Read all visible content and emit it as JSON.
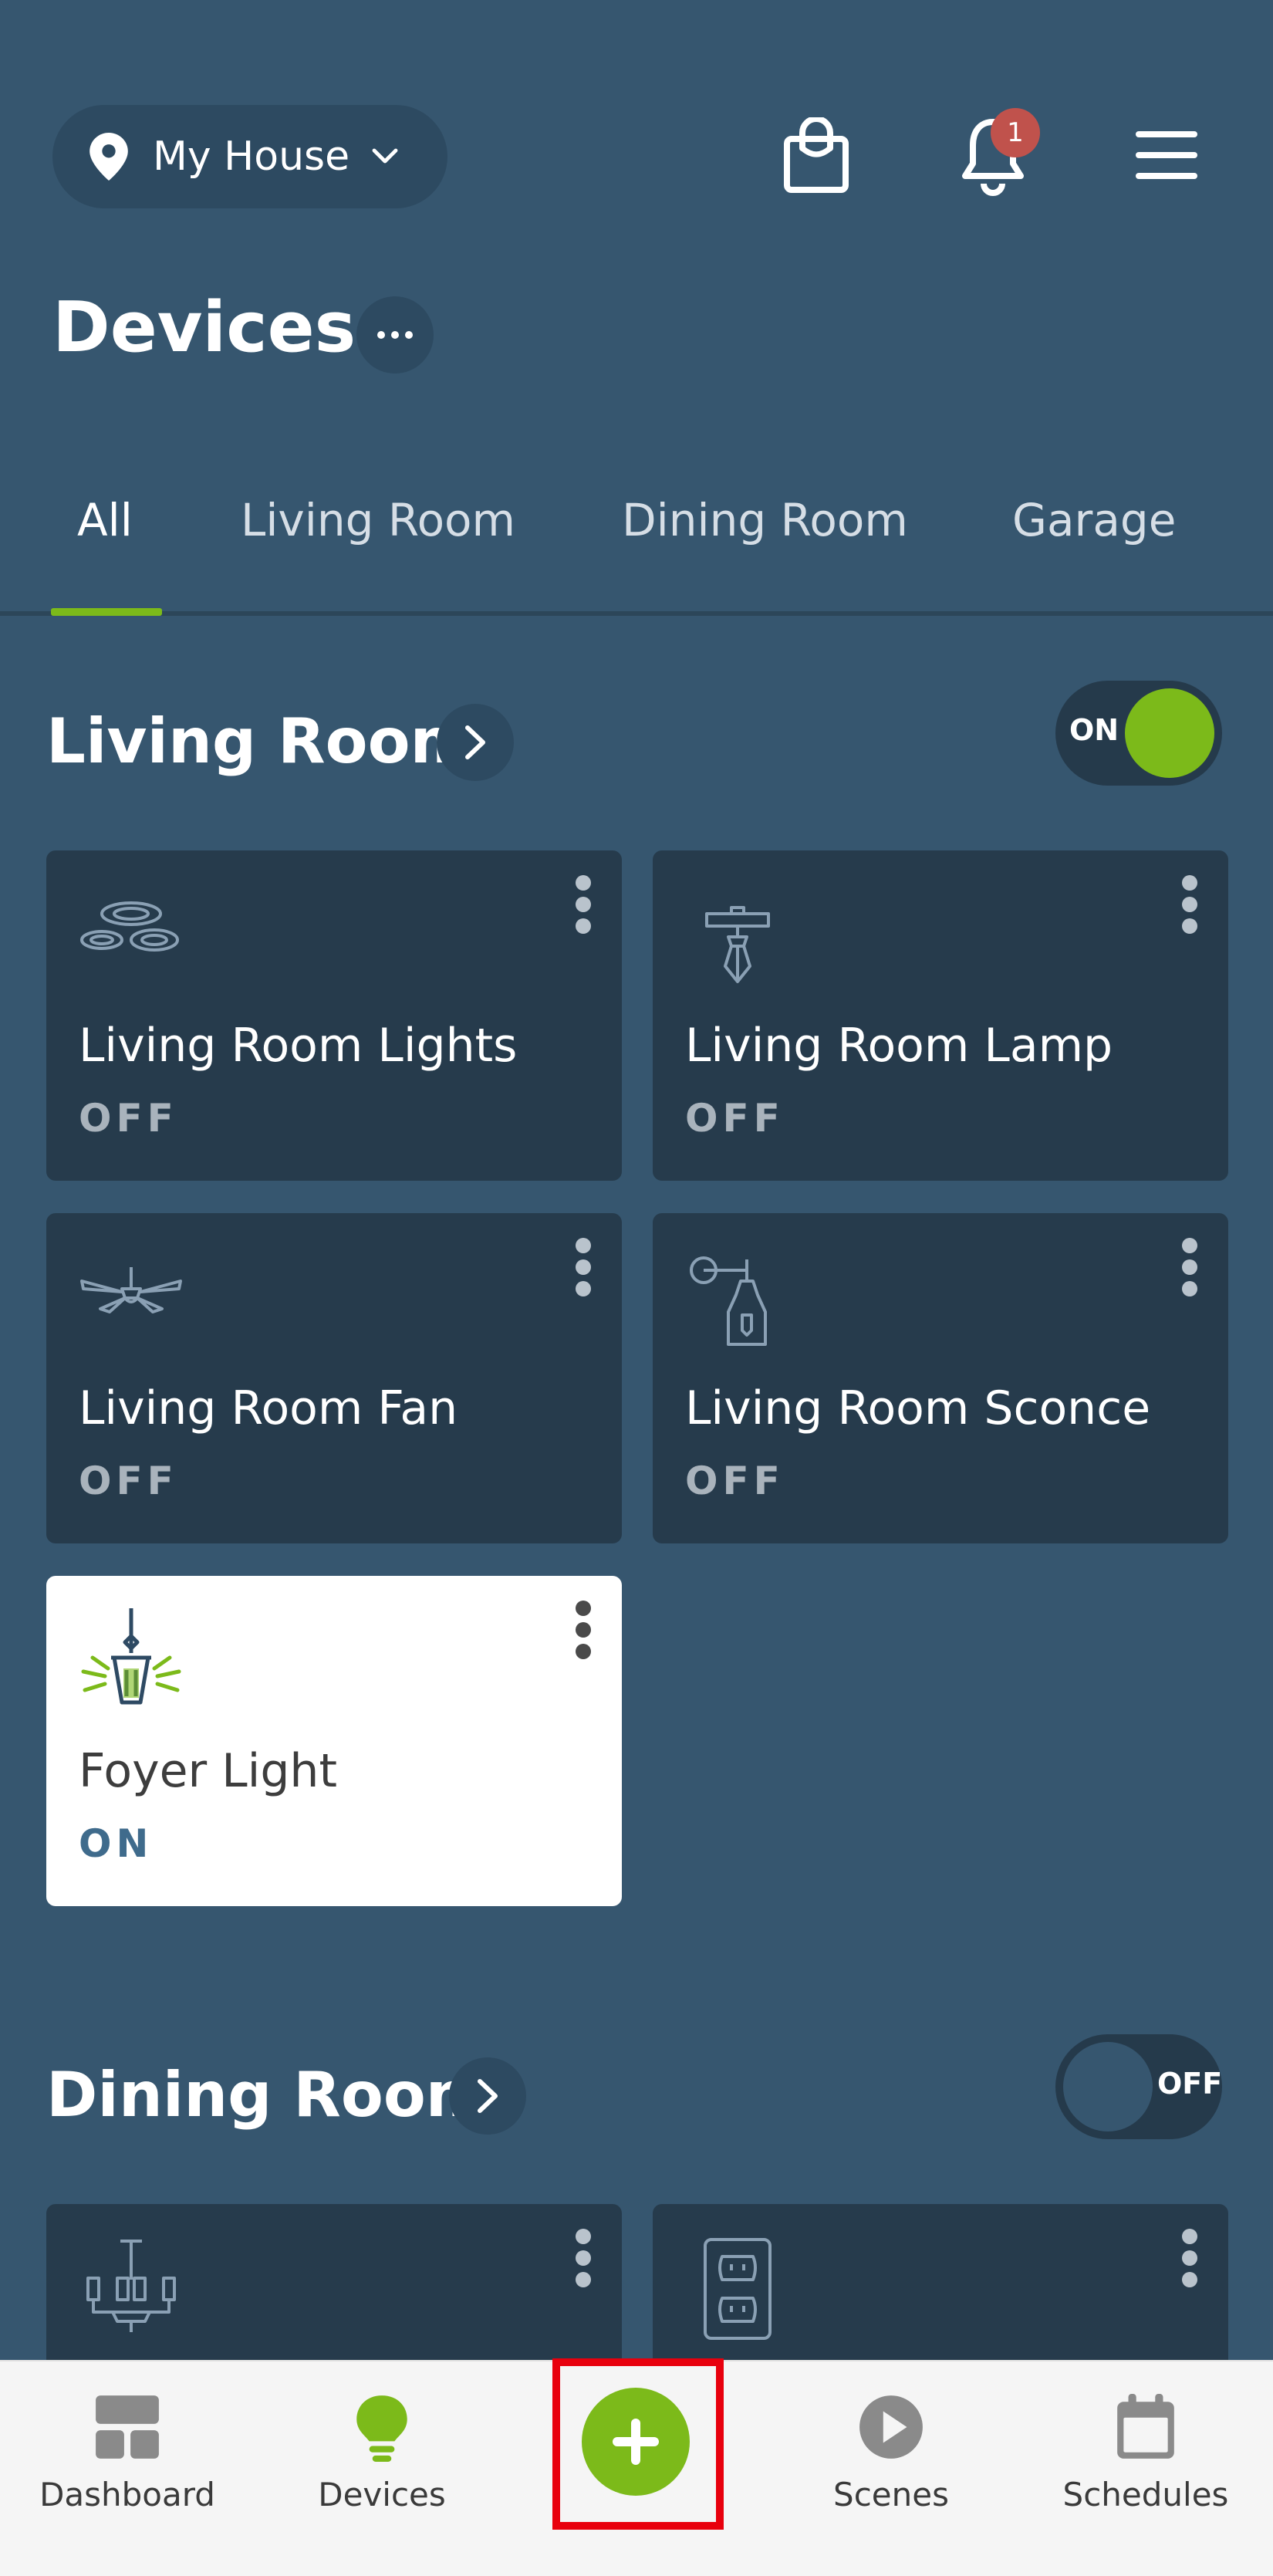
{
  "header": {
    "location": "My House",
    "notification_count": "1"
  },
  "page": {
    "title": "Devices"
  },
  "tabs": [
    {
      "label": "All",
      "active": true
    },
    {
      "label": "Living Room",
      "active": false
    },
    {
      "label": "Dining Room",
      "active": false
    },
    {
      "label": "Garage",
      "active": false
    }
  ],
  "sections": [
    {
      "title": "Living Room",
      "toggle": "ON",
      "devices": [
        {
          "name": "Living Room Lights",
          "status": "OFF",
          "icon": "recessed-lights-icon"
        },
        {
          "name": "Living Room Lamp",
          "status": "OFF",
          "icon": "table-lamp-icon"
        },
        {
          "name": "Living Room Fan",
          "status": "OFF",
          "icon": "ceiling-fan-icon"
        },
        {
          "name": "Living Room Sconce",
          "status": "OFF",
          "icon": "wall-sconce-icon"
        },
        {
          "name": "Foyer Light",
          "status": "ON",
          "icon": "pendant-lantern-icon"
        }
      ]
    },
    {
      "title": "Dining Room",
      "toggle": "OFF",
      "devices": [
        {
          "icon": "chandelier-icon"
        },
        {
          "icon": "wall-outlet-icon"
        }
      ]
    }
  ],
  "bottom_nav": [
    {
      "label": "Dashboard",
      "icon": "dashboard-icon"
    },
    {
      "label": "Devices",
      "icon": "bulb-icon"
    },
    {
      "label": "",
      "icon": "add-icon"
    },
    {
      "label": "Scenes",
      "icon": "play-icon"
    },
    {
      "label": "Schedules",
      "icon": "calendar-icon"
    }
  ],
  "colors": {
    "background": "#36566f",
    "card_off": "#263b4c",
    "accent_green": "#7cba1a",
    "badge_red": "#c0524c",
    "highlight_red": "#e8000d"
  }
}
